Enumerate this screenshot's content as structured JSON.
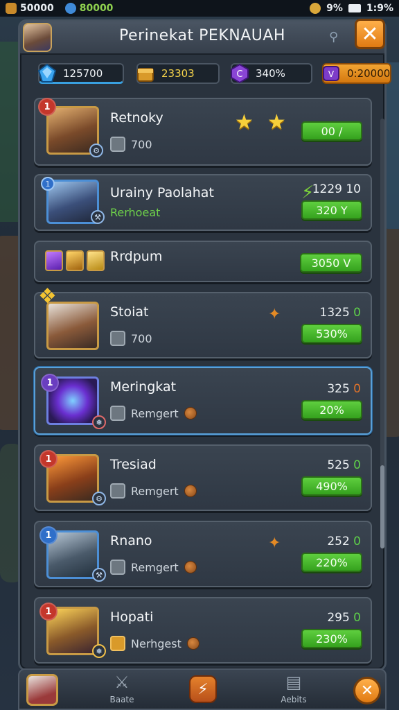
{
  "status_bar": {
    "coins": "50000",
    "gems": "80000",
    "battery": "9%",
    "time": "1:9%"
  },
  "header": {
    "title": "Perinekat PEKNAUAH",
    "close_label": "✕"
  },
  "currencies": [
    {
      "value": "125700",
      "icon": "blue-crystal-icon"
    },
    {
      "value": "23303",
      "icon": "gold-crate-icon"
    },
    {
      "value": "340%",
      "icon": "purple-gem-icon"
    },
    {
      "value": "0:20000",
      "icon": "purple-ticket-icon"
    }
  ],
  "list": [
    {
      "name": "Retnoky",
      "sub": "700",
      "badge": "1",
      "button": "00 /",
      "stars": 2
    },
    {
      "name": "Urainy Paolahat",
      "sub": "Rerhoeat",
      "badge": "1",
      "score": "1229 10",
      "button": "320 Y"
    },
    {
      "name": "Rrdpum",
      "button": "3050 V"
    },
    {
      "name": "Stoiat",
      "sub": "700",
      "score_main": "1325",
      "score_tail": "0",
      "button": "530%"
    },
    {
      "name": "Meringkat",
      "sub": "Remgert",
      "badge": "1",
      "score_main": "325",
      "score_tail": "0",
      "button": "20%"
    },
    {
      "name": "Tresiad",
      "sub": "Remgert",
      "badge": "1",
      "score_main": "525",
      "score_tail": "0",
      "button": "490%"
    },
    {
      "name": "Rnano",
      "sub": "Remgert",
      "badge": "1",
      "score_main": "252",
      "score_tail": "0",
      "button": "220%"
    },
    {
      "name": "Hopati",
      "sub": "Nerhgest",
      "badge": "1",
      "score_main": "295",
      "score_tail": "0",
      "button": "230%"
    }
  ],
  "bottom_nav": {
    "left_label": "Baate",
    "right_label": "Aebits",
    "close_label": "✕"
  },
  "colors": {
    "accent_orange": "#e07a12",
    "button_green": "#35a11e",
    "panel": "#2a333e"
  }
}
